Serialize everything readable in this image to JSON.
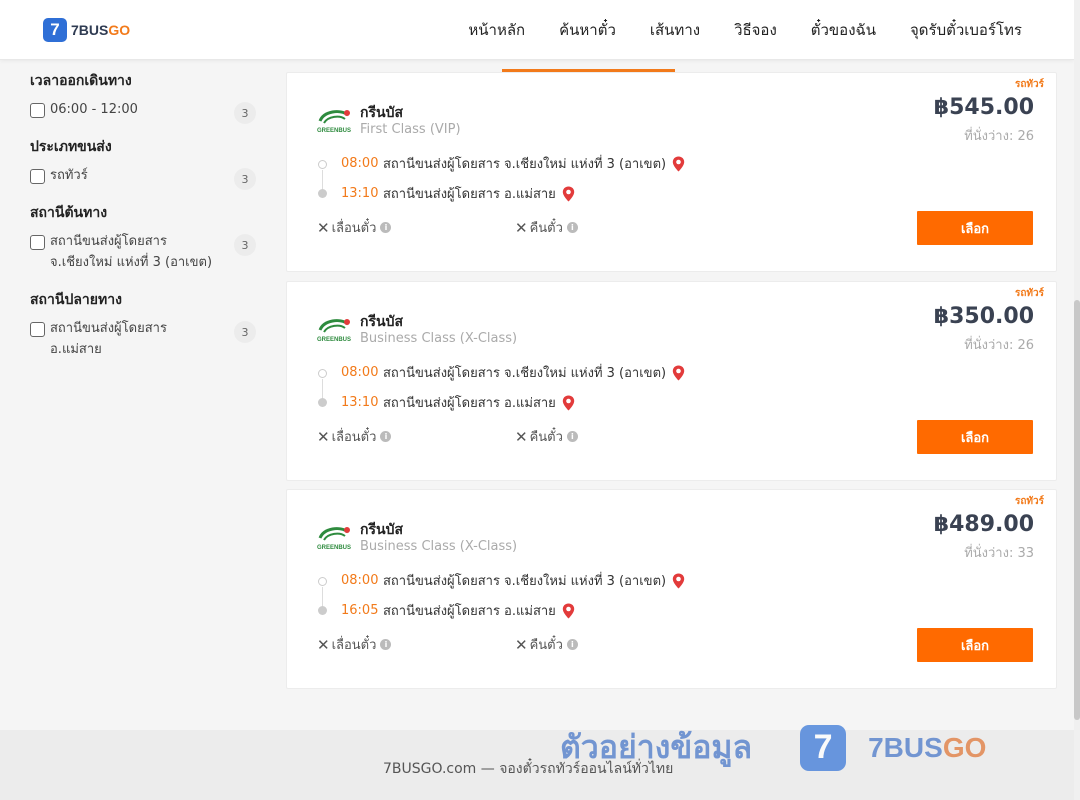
{
  "header": {
    "logo_mark": "7",
    "logo_text_part1": "7BUS",
    "logo_text_part2": "GO",
    "nav": [
      "หน้าหลัก",
      "ค้นหาตั๋ว",
      "เส้นทาง",
      "วิธีจอง",
      "ตั๋วของฉัน",
      "จุดรับตั๋วเบอร์โทร"
    ]
  },
  "filters": {
    "departure_time": {
      "title": "เวลาออกเดินทาง",
      "options": [
        {
          "label": "06:00 - 12:00",
          "count": "3"
        }
      ]
    },
    "transport_type": {
      "title": "ประเภทขนส่ง",
      "options": [
        {
          "label": "รถทัวร์",
          "count": "3"
        }
      ]
    },
    "origin": {
      "title": "สถานีต้นทาง",
      "options": [
        {
          "label": "สถานีขนส่งผู้โดยสาร จ.เชียงใหม่ แห่งที่ 3 (อาเขต)",
          "count": "3"
        }
      ]
    },
    "destination": {
      "title": "สถานีปลายทาง",
      "options": [
        {
          "label": "สถานีขนส่งผู้โดยสาร อ.แม่สาย",
          "count": "3"
        }
      ]
    }
  },
  "trips": [
    {
      "tag": "รถทัวร์",
      "operator": "กรีนบัส",
      "bus_class": "First Class (VIP)",
      "price": "฿545.00",
      "seats": "ที่นั่งว่าง: 26",
      "departure_time": "08:00",
      "departure_station": "สถานีขนส่งผู้โดยสาร จ.เชียงใหม่ แห่งที่ 3 (อาเขต)",
      "arrival_time": "13:10",
      "arrival_station": "สถานีขนส่งผู้โดยสาร อ.แม่สาย",
      "reschedule": "เลื่อนตั๋ว",
      "refund": "คืนตั๋ว",
      "select_label": "เลือก"
    },
    {
      "tag": "รถทัวร์",
      "operator": "กรีนบัส",
      "bus_class": "Business Class (X-Class)",
      "price": "฿350.00",
      "seats": "ที่นั่งว่าง: 26",
      "departure_time": "08:00",
      "departure_station": "สถานีขนส่งผู้โดยสาร จ.เชียงใหม่ แห่งที่ 3 (อาเขต)",
      "arrival_time": "13:10",
      "arrival_station": "สถานีขนส่งผู้โดยสาร อ.แม่สาย",
      "reschedule": "เลื่อนตั๋ว",
      "refund": "คืนตั๋ว",
      "select_label": "เลือก"
    },
    {
      "tag": "รถทัวร์",
      "operator": "กรีนบัส",
      "bus_class": "Business Class (X-Class)",
      "price": "฿489.00",
      "seats": "ที่นั่งว่าง: 33",
      "departure_time": "08:00",
      "departure_station": "สถานีขนส่งผู้โดยสาร จ.เชียงใหม่ แห่งที่ 3 (อาเขต)",
      "arrival_time": "16:05",
      "arrival_station": "สถานีขนส่งผู้โดยสาร อ.แม่สาย",
      "reschedule": "เลื่อนตั๋ว",
      "refund": "คืนตั๋ว",
      "select_label": "เลือก"
    }
  ],
  "footer": {
    "text": "7BUSGO.com — จองตั๋วรถทัวร์ออนไลน์ทั่วไทย"
  },
  "watermark": {
    "text": "ตัวอย่างข้อมูล",
    "mark": "7",
    "brand_part1": "7BUS",
    "brand_part2": "GO"
  },
  "colors": {
    "accent": "#ff6a00",
    "brand_blue": "#2f6fd6",
    "pin_red": "#e23b3b",
    "time_orange": "#f27a1a"
  },
  "icons": {
    "pin": "location-pin-icon",
    "x": "close-icon",
    "info": "info-icon",
    "operator": "greenbus-logo"
  }
}
